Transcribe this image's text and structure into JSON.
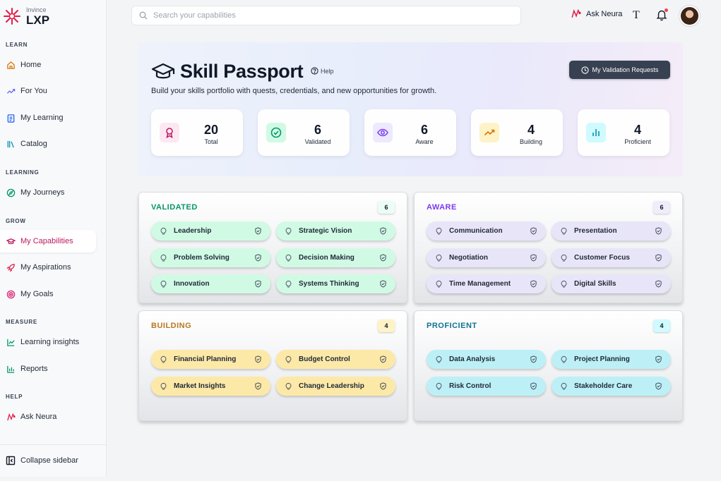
{
  "app": {
    "brand_small": "Invince",
    "brand_big": "LXP"
  },
  "sidebar": {
    "sections": [
      {
        "label": "LEARN"
      },
      {
        "label": "LEARNING"
      },
      {
        "label": "GROW"
      },
      {
        "label": "MEASURE"
      },
      {
        "label": "HELP"
      }
    ],
    "items": [
      {
        "label": "Home",
        "icon": "home-icon"
      },
      {
        "label": "For You",
        "icon": "trend-icon"
      },
      {
        "label": "My Learning",
        "icon": "clipboard-icon"
      },
      {
        "label": "Catalog",
        "icon": "library-icon"
      },
      {
        "label": "My Journeys",
        "icon": "compass-icon"
      },
      {
        "label": "My Capabilities",
        "icon": "graduation-cap-icon",
        "active": true
      },
      {
        "label": "My Aspirations",
        "icon": "rocket-icon"
      },
      {
        "label": "My Goals",
        "icon": "target-icon"
      },
      {
        "label": "Learning insights",
        "icon": "line-chart-icon"
      },
      {
        "label": "Reports",
        "icon": "bar-chart-icon"
      },
      {
        "label": "Ask Neura",
        "icon": "neura-icon"
      }
    ],
    "collapse_label": "Collapse sidebar",
    "active_color": "#be185d"
  },
  "topbar": {
    "search_placeholder": "Search your capabilities",
    "ask_neura_label": "Ask Neura"
  },
  "hero": {
    "title": "Skill Passport",
    "help_label": "Help",
    "subtitle": "Build your skills portfolio with quests, credentials, and new opportunities for growth.",
    "validation_button": "My Validation Requests",
    "stats": [
      {
        "value": "20",
        "label": "Total",
        "icon": "award-icon",
        "color": "#be185d",
        "bg": "#fce7f3"
      },
      {
        "value": "6",
        "label": "Validated",
        "icon": "check-circle-icon",
        "color": "#059669",
        "bg": "#d1fae5"
      },
      {
        "value": "6",
        "label": "Aware",
        "icon": "eye-icon",
        "color": "#7c3aed",
        "bg": "#ede9fe"
      },
      {
        "value": "4",
        "label": "Building",
        "icon": "trending-up-icon",
        "color": "#d97706",
        "bg": "#fef3c7"
      },
      {
        "value": "4",
        "label": "Proficient",
        "icon": "bar-chart-icon",
        "color": "#0891b2",
        "bg": "#cffafe"
      }
    ]
  },
  "categories": [
    {
      "title": "VALIDATED",
      "count": "6",
      "color": "#059669",
      "pill_bg": "#d1fae5",
      "count_bg": "#ecfdf5",
      "skills": [
        "Leadership",
        "Strategic Vision",
        "Problem Solving",
        "Decision Making",
        "Innovation",
        "Systems Thinking"
      ]
    },
    {
      "title": "AWARE",
      "count": "6",
      "color": "#7c3aed",
      "pill_bg": "#e9e5f8",
      "count_bg": "#f0edfb",
      "skills": [
        "Communication",
        "Presentation",
        "Negotiation",
        "Customer Focus",
        "Time Management",
        "Digital Skills"
      ]
    },
    {
      "title": "BUILDING",
      "count": "4",
      "color": "#b7791f",
      "pill_bg": "#fde9a7",
      "count_bg": "#fef3c7",
      "skills": [
        "Financial Planning",
        "Budget Control",
        "Market Insights",
        "Change Leadership"
      ]
    },
    {
      "title": "PROFICIENT",
      "count": "4",
      "color": "#0e7490",
      "pill_bg": "#bdf0f6",
      "count_bg": "#cffafe",
      "skills": [
        "Data Analysis",
        "Project Planning",
        "Risk Control",
        "Stakeholder Care"
      ]
    }
  ]
}
